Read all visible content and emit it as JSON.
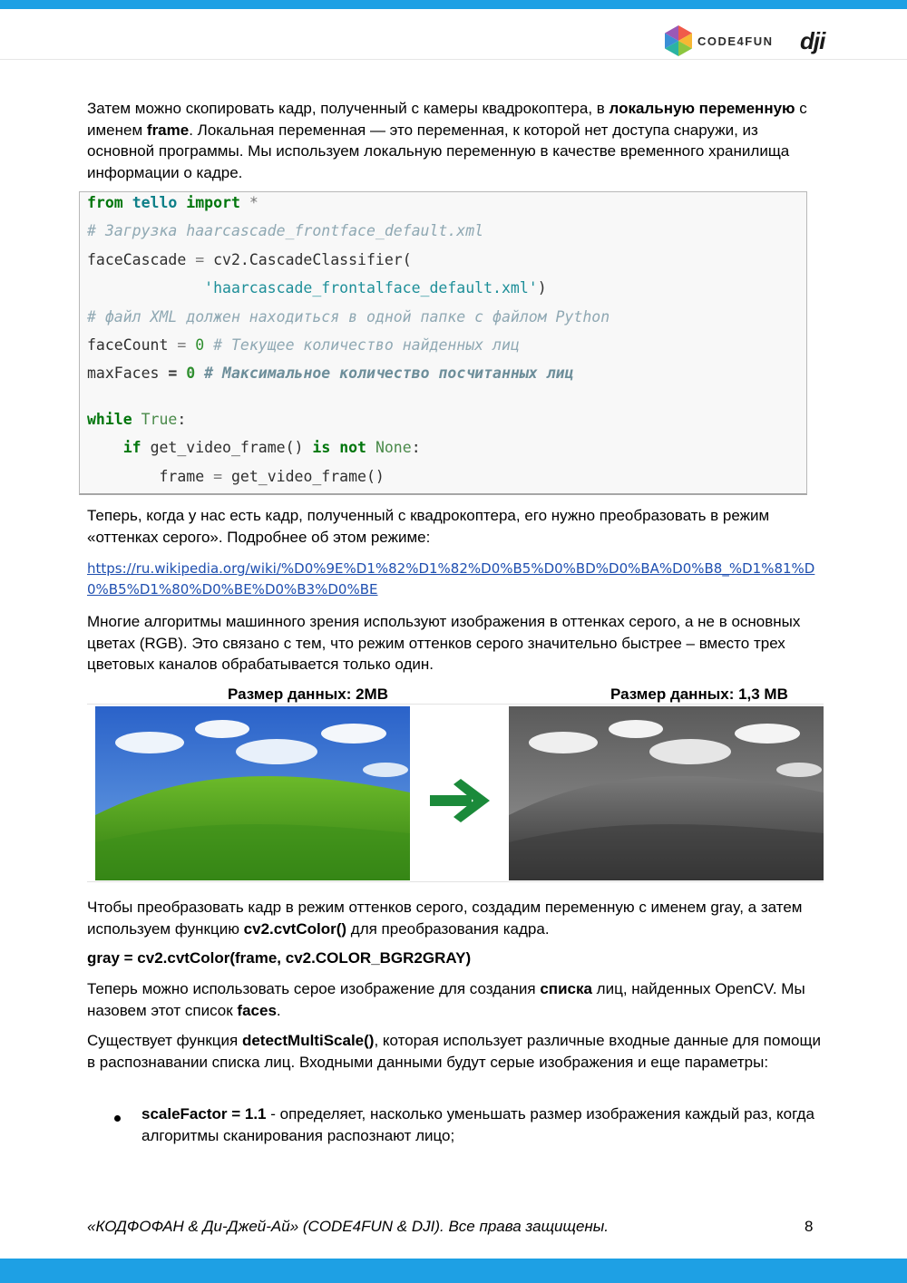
{
  "header": {
    "logo_text": "CODE4FUN",
    "dji_logo": "dji"
  },
  "paragraph1": {
    "t1": "Затем можно скопировать кадр, полученный с камеры квадрокоптера, в ",
    "b1": "локальную переменную",
    "t2": " с именем ",
    "b2": "frame",
    "t3": ". Локальная переменная — это переменная, к которой нет доступа снаружи, из основной программы. Мы используем локальную переменную в качестве временного хранилища информации о кадре."
  },
  "code": {
    "l1_kw1": "from",
    "l1_mod": "tello",
    "l1_kw2": "import",
    "l1_rest": "*",
    "l2_comment": "# Загрузка haarcascade_frontface_default.xml",
    "l3_ident": "faceCascade",
    "l3_op": "=",
    "l3_call": "cv2.CascadeClassifier(",
    "l4_str": "'haarcascade_frontalface_default.xml'",
    "l4_close": ")",
    "l5_comment": "# файл XML должен находиться в одной папке с файлом Python",
    "l6_ident": "faceCount",
    "l6_op": "=",
    "l6_num": "0",
    "l6_comment": "# Текущее количество найденных лиц",
    "l7_ident": "maxFaces",
    "l7_op": "=",
    "l7_num": "0",
    "l7_comment": "# Максимальное количество посчитанных лиц",
    "l8_kw": "while",
    "l8_const": "True",
    "l8_colon": ":",
    "l9_kw1": "if",
    "l9_call": "get_video_frame()",
    "l9_kw2": "is not",
    "l9_const": "None",
    "l9_colon": ":",
    "l10_ident": "frame",
    "l10_op": "=",
    "l10_call": "get_video_frame()"
  },
  "paragraph2": "Теперь, когда у нас есть кадр, полученный с квадрокоптера, его нужно преобразовать в режим «оттенках серого». Подробнее об этом режиме:",
  "link": "https://ru.wikipedia.org/wiki/%D0%9E%D1%82%D1%82%D0%B5%D0%BD%D0%BA%D0%B8_%D1%81%D0%B5%D1%80%D0%BE%D0%B3%D0%BE",
  "paragraph3": "Многие алгоритмы машинного зрения используют изображения в оттенках серого, а не в основных цветах (RGB). Это связано с тем, что режим оттенков серого значительно быстрее – вместо трех цветовых каналов обрабатывается только один.",
  "figure": {
    "label_left": "Размер данных: 2MB",
    "label_right": "Размер данных: 1,3 MB",
    "arrow_icon": "arrow-right-icon",
    "arrow_color": "#1b8a3a"
  },
  "paragraph4": {
    "t1": "Чтобы преобразовать кадр в режим оттенков серого, создадим переменную с именем gray, а затем используем функцию ",
    "b1": "cv2.cvtColor()",
    "t2": " для преобразования кадра."
  },
  "code_inline": "gray = cv2.cvtColor(frame, cv2.COLOR_BGR2GRAY)",
  "paragraph5": {
    "t1": "Теперь можно использовать серое изображение для создания ",
    "b1": "списка",
    "t2": " лиц, найденных OpenCV. Мы назовем этот список ",
    "b2": "faces",
    "t3": "."
  },
  "paragraph6": {
    "t1": "Существует функция  ",
    "b1": "detectMultiScale()",
    "t2": ", которая использует различные входные данные для помощи в распознавании списка лиц. Входными данными будут серые изображения и еще параметры:"
  },
  "bullet1": {
    "b1": "scaleFactor = 1.1",
    "t1": " - определяет, насколько уменьшать размер изображения каждый раз, когда алгоритмы сканирования распознают лицо;"
  },
  "footer": {
    "text": "«КОДФОФАН & Ди-Джей-Ай» (CODE4FUN & DJI). Все права защищены.",
    "page": "8"
  },
  "colors": {
    "brand_blue": "#1ea0e4",
    "link": "#1f4fb0"
  }
}
